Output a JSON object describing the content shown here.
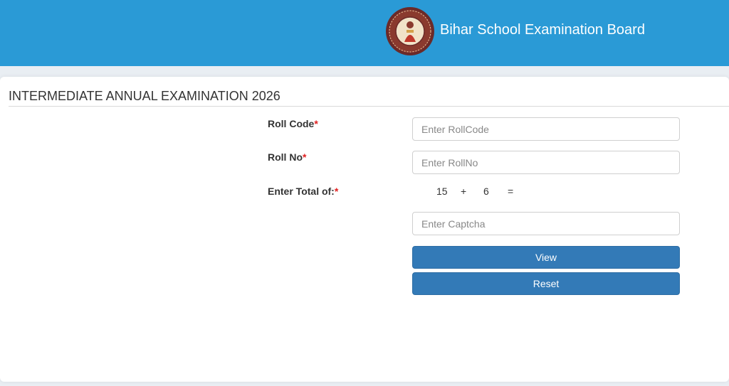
{
  "header": {
    "site_title": "Bihar School Examination Board",
    "logo_icon": "board-emblem-icon",
    "background_color": "#2a9ad6"
  },
  "page": {
    "title": "INTERMEDIATE ANNUAL EXAMINATION 2026"
  },
  "form": {
    "roll_code": {
      "label": "Roll Code",
      "required_marker": "*",
      "placeholder": "Enter RollCode",
      "value": ""
    },
    "roll_no": {
      "label": "Roll No",
      "required_marker": "*",
      "placeholder": "Enter RollNo",
      "value": ""
    },
    "captcha": {
      "label": "Enter Total of:",
      "required_marker": "*",
      "operand_a": "15",
      "operator": "+",
      "operand_b": "6",
      "equals": "=",
      "placeholder": "Enter Captcha",
      "value": ""
    },
    "view_label": "View",
    "reset_label": "Reset",
    "button_color": "#337ab7",
    "required_color": "#e02020"
  }
}
